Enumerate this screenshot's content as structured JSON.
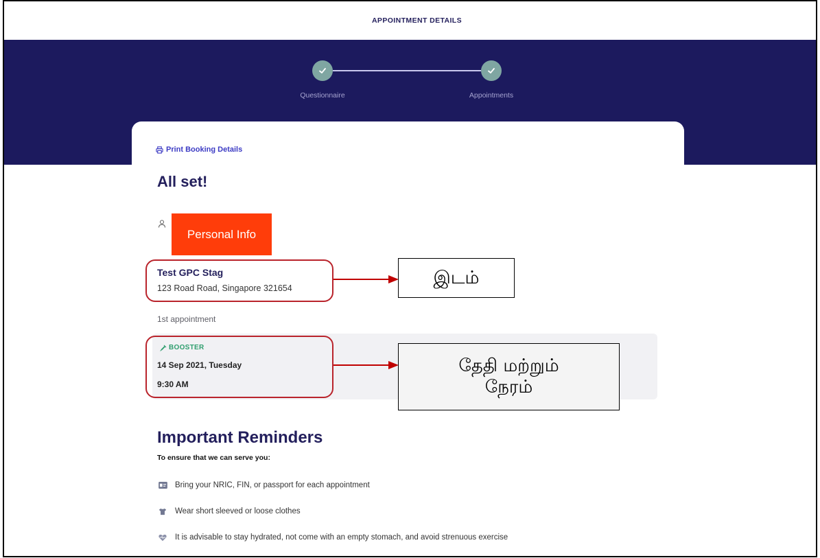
{
  "header": {
    "title": "APPOINTMENT DETAILS"
  },
  "stepper": {
    "steps": [
      {
        "label": "Questionnaire",
        "icon": "check-icon"
      },
      {
        "label": "Appointments",
        "icon": "check-icon"
      }
    ]
  },
  "booking": {
    "print_label": "Print Booking Details",
    "print_icon": "printer-icon",
    "heading": "All set!",
    "person_icon": "person-icon",
    "location": {
      "name": "Test GPC Stag",
      "address": "123 Road Road, Singapore 321654"
    },
    "appointment_label": "1st appointment",
    "appointment": {
      "type": "BOOSTER",
      "type_icon": "syringe-icon",
      "date": "14 Sep 2021, Tuesday",
      "time": "9:30 AM"
    }
  },
  "reminders": {
    "title": "Important Reminders",
    "intro": "To ensure that we can serve you:",
    "items": [
      {
        "icon": "id-card-icon",
        "text": "Bring your NRIC, FIN, or passport for each appointment"
      },
      {
        "icon": "shirt-icon",
        "text": "Wear short sleeved or loose clothes"
      },
      {
        "icon": "heart-pulse-icon",
        "text": "It is advisable to stay hydrated, not come with an empty stomach, and avoid strenuous exercise"
      }
    ]
  },
  "annotations": {
    "personal_info": "Personal Info",
    "location_callout": "இடம்",
    "datetime_callout": [
      "தேதி மற்றும்",
      "நேரம்"
    ]
  },
  "colors": {
    "navy": "#1c1a5e",
    "heading": "#231f5c",
    "link": "#3c3bc4",
    "step_complete": "#7fa6a2",
    "booster_green": "#2f9e6e",
    "annotation_red": "#b9232b",
    "redaction_orange": "#ff3d0a",
    "panel_gray": "#f1f1f4"
  }
}
